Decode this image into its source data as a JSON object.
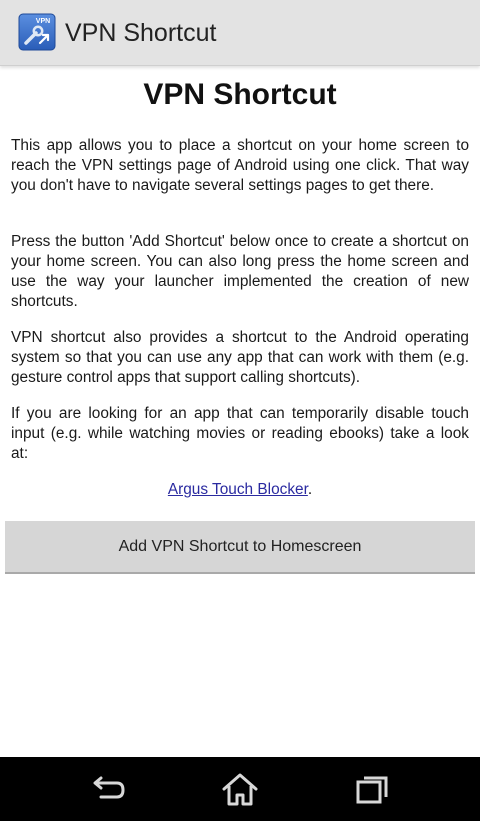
{
  "action_bar": {
    "title": "VPN Shortcut",
    "icon": "vpn-shortcut-app-icon",
    "icon_badge": "VPN",
    "background_color": "#e3e3e3"
  },
  "main": {
    "heading": "VPN Shortcut",
    "paragraphs": [
      "This app allows you to place a shortcut on your home screen to reach the VPN settings page of Android using one click. That way you don't have to navigate several settings pages to get there.",
      "Press the button 'Add Shortcut' below once to create a shortcut on your home screen. You can also long press the home screen and use the way your launcher implemented the creation of new shortcuts.",
      "VPN shortcut also provides a shortcut to the Android operating system so that you can use any app that can work with them (e.g. gesture control apps that support calling shortcuts).",
      "If you are looking for an app that can temporarily disable touch input (e.g. while watching movies or reading ebooks) take a look at:"
    ],
    "link_text": "Argus Touch Blocker",
    "link_suffix": ".",
    "link_color": "#2a2aa0",
    "add_button_label": "Add VPN Shortcut to Homescreen"
  },
  "nav_bar": {
    "back_icon": "back-icon",
    "home_icon": "home-icon",
    "recents_icon": "recents-icon",
    "background_color": "#000000"
  }
}
